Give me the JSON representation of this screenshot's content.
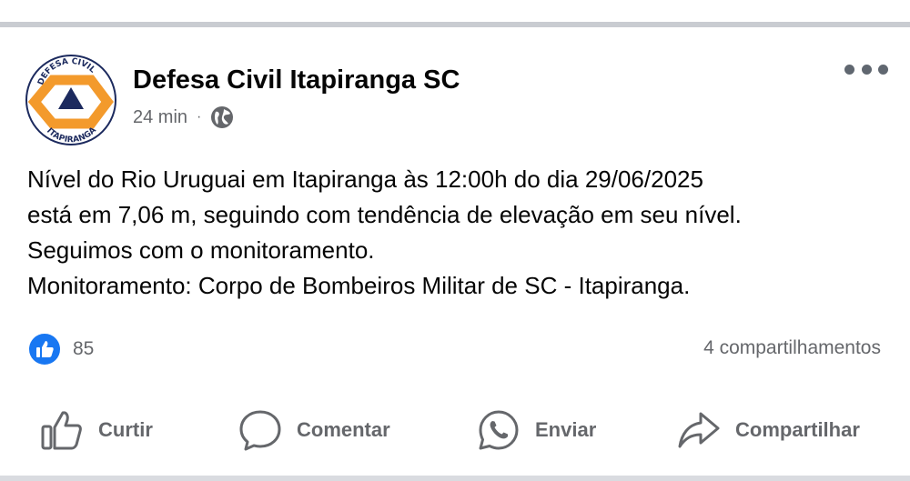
{
  "post": {
    "page_name": "Defesa Civil Itapiranga SC",
    "avatar_top_text": "DEFESA CIVIL",
    "avatar_bottom_text": "ITAPIRANGA",
    "time": "24 min",
    "separator": "·",
    "privacy_icon": "globe-icon",
    "more_icon": "ellipsis-icon",
    "text_lines": [
      "Nível do Rio Uruguai em Itapiranga às 12:00h do dia 29/06/2025",
      "está em 7,06 m, seguindo com tendência de elevação em seu nível.",
      "Seguimos com o monitoramento.",
      "Monitoramento: Corpo de Bombeiros Militar de SC - Itapiranga."
    ]
  },
  "engagement": {
    "reaction_icon": "like-icon",
    "reaction_count": "85",
    "shares": "4 compartilhamentos"
  },
  "actions": [
    {
      "label": "Curtir",
      "icon": "thumbs-up-icon"
    },
    {
      "label": "Comentar",
      "icon": "comment-bubble-icon"
    },
    {
      "label": "Enviar",
      "icon": "whatsapp-icon"
    },
    {
      "label": "Compartilhar",
      "icon": "share-arrow-icon"
    }
  ],
  "colors": {
    "accent": "#1877f2",
    "muted_text": "#65676b",
    "logo_orange": "#f39a2c",
    "logo_navy": "#1c2a5e"
  }
}
